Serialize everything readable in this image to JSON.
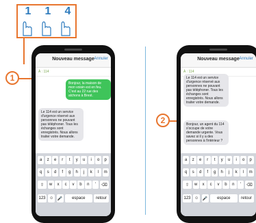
{
  "keypad_callout": {
    "digits": [
      "1",
      "1",
      "4"
    ]
  },
  "steps": {
    "one": "1",
    "two": "2"
  },
  "left_phone": {
    "header": {
      "title": "Nouveau message",
      "cancel": "Annuler"
    },
    "recipient": "À : 114",
    "messages": [
      {
        "from": "user",
        "text": "Bonjour, la maison de mon voisin est en feu. C'est au 22 rue des alchons à Brest."
      },
      {
        "from": "service",
        "text": "Le 114 est un service d'urgence réservé aux personnes ne pouvant pas téléphoner. Tous les échanges sont enregistrés. Nous allons traiter votre demande."
      }
    ]
  },
  "right_phone": {
    "header": {
      "title": "Nouveau message",
      "cancel": "Annuler"
    },
    "recipient": "À : 114",
    "messages": [
      {
        "from": "service",
        "text": "Le 114 est un service d'urgence réservé aux personnes ne pouvant pas téléphoner. Tous les échanges sont enregistrés. Nous allons traiter votre demande."
      },
      {
        "from": "service",
        "text": "Bonjour, un agent du 114 s'occupe de votre demande urgente. Vous savez si il y a des personnes à l'intérieur ?"
      }
    ]
  },
  "keyboard": {
    "row1": [
      "a",
      "z",
      "e",
      "r",
      "t",
      "y",
      "u",
      "i",
      "o",
      "p"
    ],
    "row2": [
      "q",
      "s",
      "d",
      "f",
      "g",
      "h",
      "j",
      "k",
      "l",
      "m"
    ],
    "row3": [
      "w",
      "x",
      "c",
      "v",
      "b",
      "n",
      "'"
    ],
    "shift": "⇧",
    "delete": "⌫",
    "numbers": "123",
    "emoji": "☺",
    "mic": "🎤",
    "space": "espace",
    "return": "retour"
  },
  "colors": {
    "accent": "#e8752e",
    "blue": "#2e7bbd",
    "bubble_out": "#3fc45a",
    "bubble_in": "#e6e6ea"
  }
}
